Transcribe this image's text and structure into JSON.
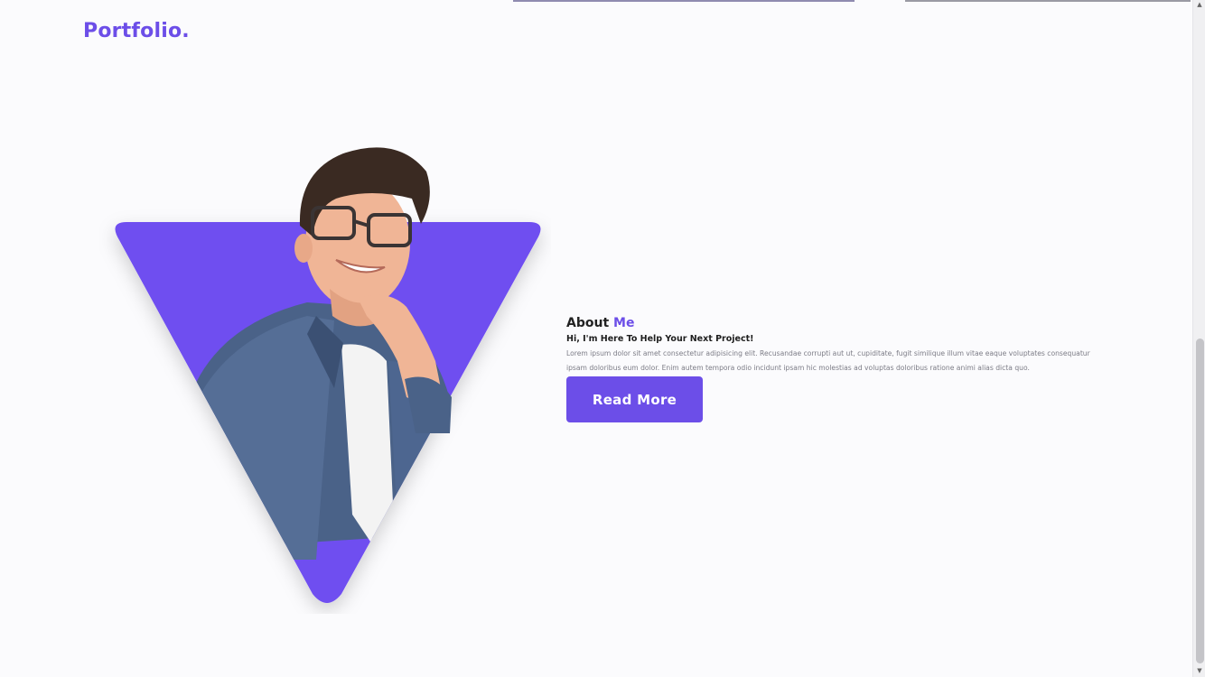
{
  "header": {
    "logo": "Portfolio."
  },
  "hero": {
    "image_description_icon": "person-photo",
    "shape_color": "#6c4ee8"
  },
  "about": {
    "title_prefix": "About ",
    "title_accent": "Me",
    "subtitle": "Hi, I'm Here To Help Your Next Project!",
    "body": "Lorem ipsum dolor sit amet consectetur adipisicing elit. Recusandae corrupti aut ut, cupiditate, fugit similique illum vitae eaque voluptates consequatur ipsam doloribus eum dolor. Enim autem tempora odio incidunt ipsam hic molestias ad voluptas doloribus ratione animi alias dicta quo.",
    "button_label": "Read More"
  },
  "colors": {
    "accent": "#6c4ee8",
    "background": "#fbfbfd"
  }
}
